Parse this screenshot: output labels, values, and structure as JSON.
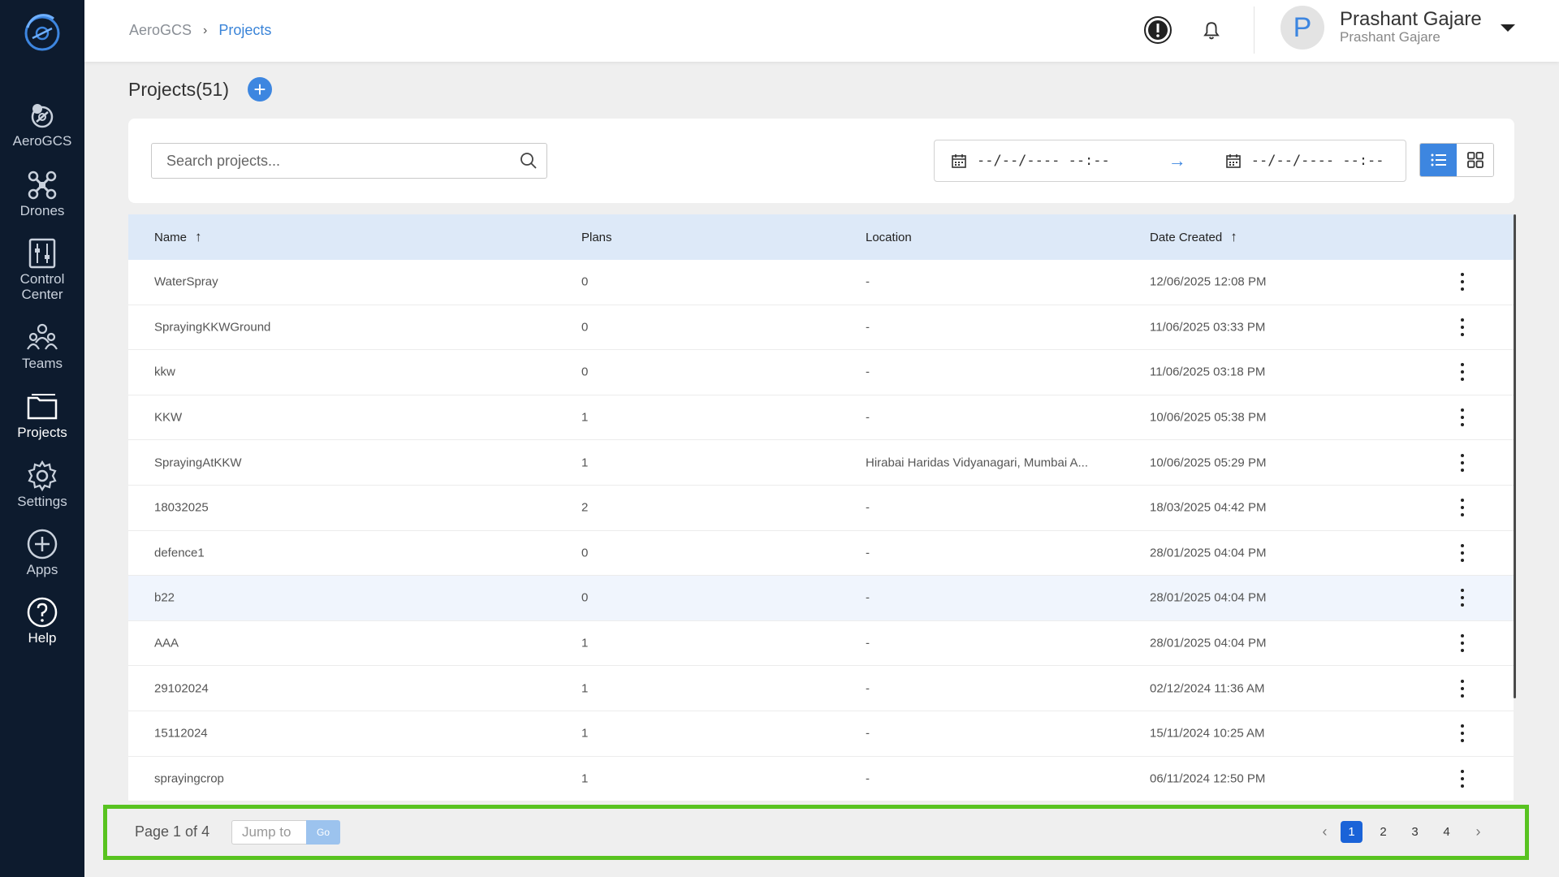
{
  "app": {
    "name": "AeroGCS"
  },
  "sidebar": {
    "items": [
      {
        "label": "AeroGCS",
        "icon": "aerogcs-drone-icon"
      },
      {
        "label": "Drones",
        "icon": "drone-icon"
      },
      {
        "label": "Control Center",
        "icon": "control-sliders-icon"
      },
      {
        "label": "Teams",
        "icon": "team-icon"
      },
      {
        "label": "Projects",
        "icon": "folder-icon",
        "active": true
      },
      {
        "label": "Settings",
        "icon": "gear-icon"
      },
      {
        "label": "Apps",
        "icon": "plus-circle-icon"
      },
      {
        "label": "Help",
        "icon": "help-icon"
      }
    ]
  },
  "header": {
    "breadcrumb_root": "AeroGCS",
    "breadcrumb_sep": "›",
    "breadcrumb_current": "Projects",
    "user_initial": "P",
    "user_name": "Prashant Gajare",
    "user_subtitle": "Prashant Gajare"
  },
  "page": {
    "title": "Projects(51)",
    "add_label": "+"
  },
  "filters": {
    "search_placeholder": "Search projects...",
    "date_from": "--/--/---- --:--",
    "date_arrow": "→",
    "date_to": "--/--/---- --:--"
  },
  "table": {
    "columns": {
      "name": "Name",
      "plans": "Plans",
      "location": "Location",
      "date": "Date Created"
    },
    "sort_arrow": "↑",
    "rows": [
      {
        "name": "WaterSpray",
        "plans": "0",
        "location": "-",
        "date": "12/06/2025 12:08 PM"
      },
      {
        "name": "SprayingKKWGround",
        "plans": "0",
        "location": "-",
        "date": "11/06/2025 03:33 PM"
      },
      {
        "name": "kkw",
        "plans": "0",
        "location": "-",
        "date": "11/06/2025 03:18 PM"
      },
      {
        "name": "KKW",
        "plans": "1",
        "location": "-",
        "date": "10/06/2025 05:38 PM"
      },
      {
        "name": "SprayingAtKKW",
        "plans": "1",
        "location": "Hirabai Haridas Vidyanagari, Mumbai A...",
        "date": "10/06/2025 05:29 PM"
      },
      {
        "name": "18032025",
        "plans": "2",
        "location": "-",
        "date": "18/03/2025 04:42 PM"
      },
      {
        "name": "defence1",
        "plans": "0",
        "location": "-",
        "date": "28/01/2025 04:04 PM"
      },
      {
        "name": "b22",
        "plans": "0",
        "location": "-",
        "date": "28/01/2025 04:04 PM"
      },
      {
        "name": "AAA",
        "plans": "1",
        "location": "-",
        "date": "28/01/2025 04:04 PM"
      },
      {
        "name": "29102024",
        "plans": "1",
        "location": "-",
        "date": "02/12/2024 11:36 AM"
      },
      {
        "name": "15112024",
        "plans": "1",
        "location": "-",
        "date": "15/11/2024 10:25 AM"
      },
      {
        "name": "sprayingcrop",
        "plans": "1",
        "location": "-",
        "date": "06/11/2024 12:50 PM"
      }
    ]
  },
  "pagination": {
    "info": "Page 1 of 4",
    "jump_placeholder": "Jump to",
    "go_label": "Go",
    "prev": "‹",
    "next": "›",
    "pages": [
      "1",
      "2",
      "3",
      "4"
    ],
    "current": "1"
  },
  "colors": {
    "sidebar_bg": "#0d1b2e",
    "accent": "#3d86e0",
    "header_row_bg": "#dde9f8",
    "highlight_outline": "#58c320"
  }
}
